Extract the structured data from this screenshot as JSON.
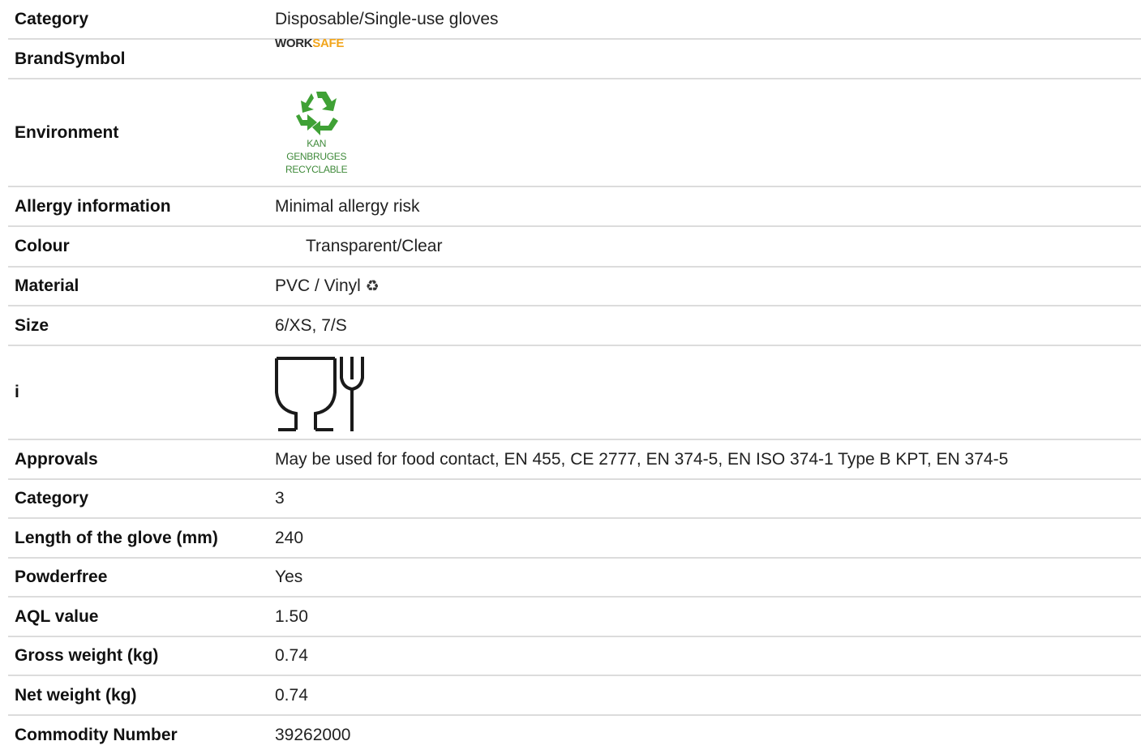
{
  "rows": {
    "category": {
      "label": "Category",
      "value": "Disposable/Single-use gloves"
    },
    "brand": {
      "label": "BrandSymbol",
      "logo_work": "WORK",
      "logo_safe": "SAFE"
    },
    "environment": {
      "label": "Environment",
      "badge_line1": "KAN",
      "badge_line2": "GENBRUGES",
      "badge_line3": "RECYCLABLE"
    },
    "allergy": {
      "label": "Allergy information",
      "value": "Minimal allergy risk"
    },
    "colour": {
      "label": "Colour",
      "value": "Transparent/Clear"
    },
    "material": {
      "label": "Material",
      "value": "PVC / Vinyl",
      "icon": "recycle-icon"
    },
    "size": {
      "label": "Size",
      "value": "6/XS, 7/S"
    },
    "info": {
      "label": "i",
      "icon": "food-safe-icon"
    },
    "approvals": {
      "label": "Approvals",
      "value": "May be used for food contact, EN 455, CE 2777, EN 374-5, EN ISO 374-1 Type B KPT, EN 374-5"
    },
    "category_level": {
      "label": "Category",
      "value": "3"
    },
    "length": {
      "label": "Length of the glove (mm)",
      "value": "240"
    },
    "powderfree": {
      "label": "Powderfree",
      "value": "Yes"
    },
    "aql": {
      "label": "AQL value",
      "value": "1.50"
    },
    "gross_weight": {
      "label": "Gross weight (kg)",
      "value": "0.74"
    },
    "net_weight": {
      "label": "Net weight (kg)",
      "value": "0.74"
    },
    "commodity": {
      "label": "Commodity Number",
      "value": "39262000"
    }
  },
  "colors": {
    "brand_safe": "#f2a51b",
    "recycle_green": "#3f8a3a",
    "divider": "#dcdcdc"
  }
}
